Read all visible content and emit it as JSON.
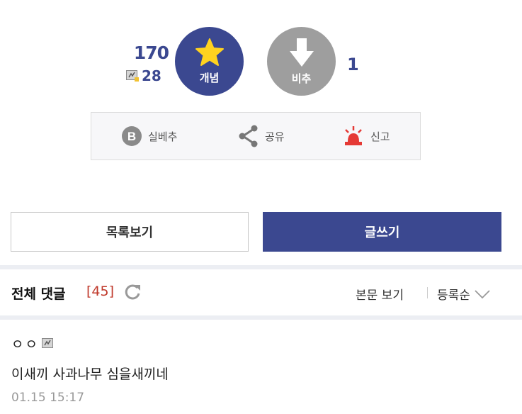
{
  "vote": {
    "up_count": "170",
    "fixed_count": "28",
    "up_label": "개념",
    "down_label": "비추",
    "down_count": "1",
    "up_color": "#3b4890",
    "down_color": "#9e9e9e",
    "star_color": "#ffd21f"
  },
  "actions": {
    "best_badge": "B",
    "best_label": "실베추",
    "share_label": "공유",
    "report_label": "신고",
    "report_color": "#e53935"
  },
  "buttons": {
    "list_label": "목록보기",
    "write_label": "글쓰기"
  },
  "comments_header": {
    "title": "전체 댓글",
    "count": "[45]",
    "view_body": "본문 보기",
    "sort": "등록순"
  },
  "comments": [
    {
      "author": "ㅇㅇ",
      "text": "이새끼 사과나무 심을새끼네",
      "date": "01.15 15:17"
    }
  ]
}
